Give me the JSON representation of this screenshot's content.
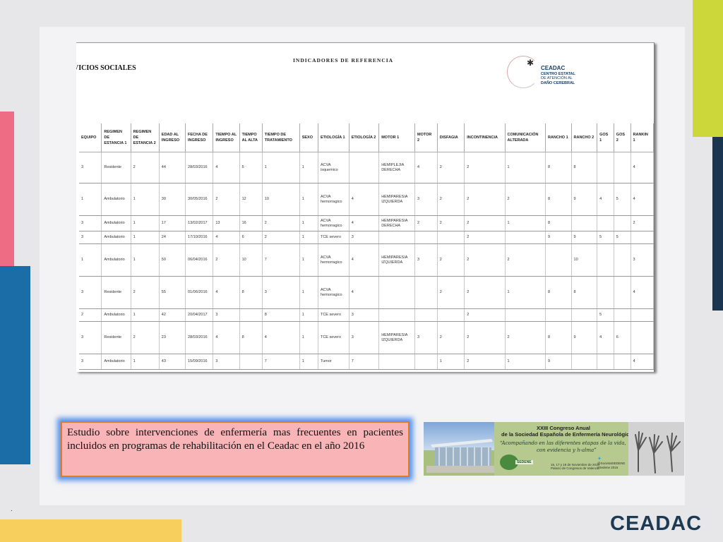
{
  "colors": {
    "background": "#e7e7ea",
    "lime_accent": "#ccd83a",
    "navy_accent": "#1a3550",
    "pink_accent": "#ee6c84",
    "blue_accent": "#1b6da8",
    "yellow_accent": "#f7cf5d",
    "caption_fill": "#f9b4b8",
    "caption_border": "#e07a2a",
    "caption_glow": "#3c82e6",
    "brand_text": "#1e3a52"
  },
  "document": {
    "title": "INDICADORES DE REFERENCIA",
    "services_heading": "VICIOS SOCIALES",
    "logo": {
      "icon": "ceadac-star-ring-icon",
      "name": "CEADAC",
      "line1": "CENTRO ESTATAL",
      "line2": "DE ATENCIÓN AL",
      "line3": "DAÑO CEREBRAL"
    },
    "table": {
      "headers": [
        "EQUIPO",
        "REGIMEN DE ESTANCIA 1",
        "REGIMEN DE ESTANCIA 2",
        "EDAD AL INGRESO",
        "FECHA DE INGRESO",
        "TIEMPO AL INGRESO",
        "TIEMPO AL ALTA",
        "TIEMPO DE TRATAMIENTO",
        "SEXO",
        "ETIOLOGÍA 1",
        "ETIOLOGÍA 2",
        "MOTOR 1",
        "MOTOR 2",
        "DISFAGIA",
        "INCONTINENCIA",
        "COMUNICACIÓN ALTERADA",
        "RANCHO 1",
        "RANCHO 2",
        "GOS 1",
        "GOS 2",
        "RANKIN 1"
      ],
      "rows": [
        [
          "3",
          "Residente",
          "2",
          "44",
          "28/03/2016",
          "4",
          "5",
          "1",
          "1",
          "ACVA isquemico",
          "",
          "HEMIPLEJIA DERECHA",
          "4",
          "2",
          "2",
          "1",
          "8",
          "8",
          "",
          "",
          "4"
        ],
        [
          "1",
          "Ambulatorio",
          "1",
          "30",
          "30/05/2016",
          "2",
          "12",
          "10",
          "1",
          "ACVA hemorragico",
          "4",
          "HEMIPARESIA IZQUIERDA",
          "3",
          "2",
          "2",
          "2",
          "8",
          "9",
          "4",
          "5",
          "4"
        ],
        [
          "3",
          "Ambulatorio",
          "1",
          "17",
          "13/02/2017",
          "13",
          "16",
          "2",
          "1",
          "ACVA hemorragico",
          "4",
          "HEMIPARESIA DERECHA",
          "2",
          "2",
          "2",
          "1",
          "8",
          "",
          "",
          "",
          "2"
        ],
        [
          "3",
          "Ambulatorio",
          "1",
          "24",
          "17/10/2016",
          "4",
          "6",
          "2",
          "1",
          "TCE severo",
          "3",
          "",
          "",
          "",
          "2",
          "",
          "9",
          "9",
          "5",
          "5",
          ""
        ],
        [
          "1",
          "Ambulatorio",
          "1",
          "50",
          "06/04/2016",
          "2",
          "10",
          "7",
          "1",
          "ACVA hemorragico",
          "4",
          "HEMIPARESIA IZQUIERDA",
          "3",
          "2",
          "2",
          "2",
          "",
          "10",
          "",
          "",
          "3"
        ],
        [
          "3",
          "Residente",
          "2",
          "55",
          "01/06/2016",
          "4",
          "8",
          "3",
          "1",
          "ACVA hemorragico",
          "4",
          "",
          "",
          "2",
          "2",
          "1",
          "8",
          "8",
          "",
          "",
          "4"
        ],
        [
          "2",
          "Ambulatorio",
          "1",
          "42",
          "20/04/2017",
          "3",
          "",
          "8",
          "1",
          "TCE severo",
          "3",
          "",
          "",
          "",
          "2",
          "",
          "",
          "",
          "5",
          "",
          ""
        ],
        [
          "3",
          "Residente",
          "2",
          "23",
          "28/03/2016",
          "4",
          "8",
          "4",
          "1",
          "TCE severo",
          "3",
          "HEMIPARESIA IZQUIERDA",
          "3",
          "2",
          "2",
          "2",
          "8",
          "9",
          "4",
          "6",
          ""
        ],
        [
          "3",
          "Ambulatorio",
          "1",
          "43",
          "15/09/2016",
          "3",
          "",
          "7",
          "1",
          "Tumor",
          "7",
          "",
          "",
          "1",
          "2",
          "1",
          "9",
          "",
          "",
          "",
          "4"
        ]
      ]
    }
  },
  "caption": {
    "text": "Estudio sobre intervenciones de enfermería mas frecuentes en pacientes incluidos en programas de rehabilitación en el Ceadac en el año 2016"
  },
  "banner": {
    "title1": "XXIII Congreso Anual",
    "title2": "de la Sociedad Española de Enfermería Neurológica",
    "slogan1": "“Acompañando en las diferentes etapas de la vida,",
    "slogan2": "con evidencia y h-alma”",
    "dates": "16, 17 y 18 de Noviembre de 2016",
    "venue": "Palacio de Congresos de Valencia",
    "handle": "@SocietatSEDENE",
    "hashtag": "#Sedene 2016",
    "org": "SEDENE"
  },
  "footer": {
    "dot": ".",
    "brand": "CEADAC"
  }
}
